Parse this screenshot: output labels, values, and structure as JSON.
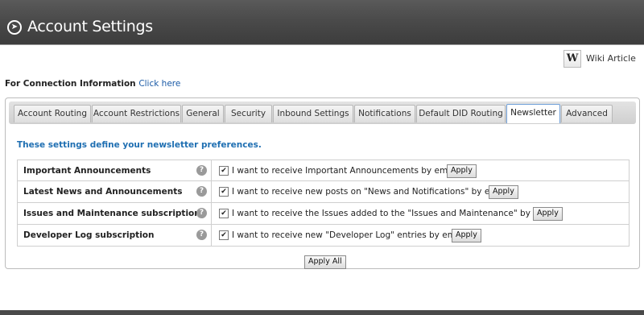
{
  "header": {
    "title": "Account Settings"
  },
  "wiki": {
    "icon": "W",
    "label": "Wiki Article"
  },
  "connection": {
    "label": "For Connection Information",
    "link": "Click here"
  },
  "tabs": [
    {
      "label": "Account Routing"
    },
    {
      "label": "Account Restrictions"
    },
    {
      "label": "General"
    },
    {
      "label": "Security"
    },
    {
      "label": "Inbound Settings"
    },
    {
      "label": "Notifications"
    },
    {
      "label": "Default DID Routing"
    },
    {
      "label": "Newsletter",
      "active": true
    },
    {
      "label": "Advanced"
    }
  ],
  "intro": "These settings define your newsletter preferences.",
  "settings": [
    {
      "label": "Important Announcements",
      "checked": true,
      "description": "I want to receive Important Announcements by email.",
      "button": "Apply"
    },
    {
      "label": "Latest News and Announcements",
      "checked": true,
      "description": "I want to receive new posts on \"News and Notifications\" by email.",
      "button": "Apply"
    },
    {
      "label": "Issues and Maintenance subscription",
      "checked": true,
      "description": "I want to receive the Issues added to the \"Issues and Maintenance\" by email.",
      "button": "Apply"
    },
    {
      "label": "Developer Log subscription",
      "checked": true,
      "description": "I want to receive new \"Developer Log\" entries by email.",
      "button": "Apply"
    }
  ],
  "apply_all": "Apply All",
  "help_icon": "?",
  "check_mark": "✔",
  "header_icon": "➤",
  "colors": {
    "accent": "#1f6fb2",
    "link": "#1a5aa6",
    "header": "#4a4a4a"
  }
}
